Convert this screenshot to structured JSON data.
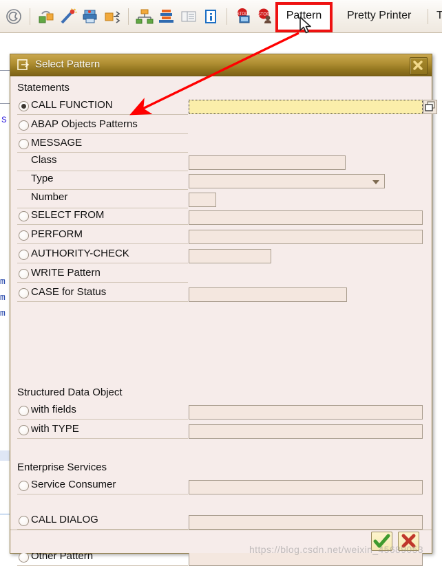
{
  "toolbar": {
    "icons": [
      {
        "name": "at-spiral-icon"
      },
      {
        "name": "package-check-icon"
      },
      {
        "name": "magic-wand-icon"
      },
      {
        "name": "printer-icon"
      },
      {
        "name": "expand-arrows-icon"
      },
      {
        "name": "hierarchy-icon"
      },
      {
        "name": "stack-layers-icon"
      },
      {
        "name": "list-table-icon"
      },
      {
        "name": "info-icon"
      },
      {
        "name": "debug-monitor-icon"
      },
      {
        "name": "stop-user-icon"
      }
    ],
    "pattern_label": "Pattern",
    "pretty_printer_label": "Pretty Printer",
    "trailing_label": "T",
    "highlight_color": "#ee1111"
  },
  "background": {
    "fragments": [
      "S",
      "m",
      "m",
      "m"
    ]
  },
  "dialog": {
    "title": "Select Pattern",
    "title_icon": "pattern-window-icon",
    "close_icon": "close-icon",
    "groups": {
      "statements": "Statements",
      "structured": "Structured Data Object",
      "enterprise": "Enterprise Services"
    },
    "options": [
      {
        "id": "call-function",
        "label": "CALL FUNCTION",
        "selected": true,
        "field": "text",
        "value": "",
        "has_picker": true
      },
      {
        "id": "abap-objects",
        "label": "ABAP Objects Patterns",
        "selected": false,
        "field": "none",
        "value": ""
      },
      {
        "id": "message",
        "label": "MESSAGE",
        "selected": false,
        "field": "none",
        "value": ""
      },
      {
        "id": "select-from",
        "label": "SELECT FROM",
        "selected": false,
        "field": "text",
        "value": ""
      },
      {
        "id": "perform",
        "label": "PERFORM",
        "selected": false,
        "field": "text",
        "value": ""
      },
      {
        "id": "authority-check",
        "label": "AUTHORITY-CHECK",
        "selected": false,
        "field": "text",
        "value": ""
      },
      {
        "id": "write-pattern",
        "label": "WRITE Pattern",
        "selected": false,
        "field": "none",
        "value": ""
      },
      {
        "id": "case-for-status",
        "label": "CASE for Status",
        "selected": false,
        "field": "text",
        "value": ""
      },
      {
        "id": "with-fields",
        "label": "with fields",
        "selected": false,
        "field": "text",
        "value": ""
      },
      {
        "id": "with-type",
        "label": "with TYPE",
        "selected": false,
        "field": "text",
        "value": ""
      },
      {
        "id": "service-consumer",
        "label": "Service Consumer",
        "selected": false,
        "field": "text",
        "value": ""
      },
      {
        "id": "call-dialog",
        "label": "CALL DIALOG",
        "selected": false,
        "field": "text",
        "value": ""
      },
      {
        "id": "other-pattern",
        "label": "Other Pattern",
        "selected": false,
        "field": "text",
        "value": ""
      }
    ],
    "message_fields": [
      {
        "id": "class",
        "label": "Class",
        "value": "",
        "kind": "text"
      },
      {
        "id": "type",
        "label": "Type",
        "value": "",
        "kind": "combo"
      },
      {
        "id": "number",
        "label": "Number",
        "value": "",
        "kind": "text"
      }
    ],
    "buttons": {
      "ok": {
        "name": "confirm-button",
        "icon": "green-check-icon"
      },
      "cancel": {
        "name": "cancel-button",
        "icon": "red-cross-icon"
      }
    }
  },
  "annotation": {
    "arrow_color": "#ff0000",
    "watermark": "https://blog.csdn.net/weixin_45689053"
  }
}
